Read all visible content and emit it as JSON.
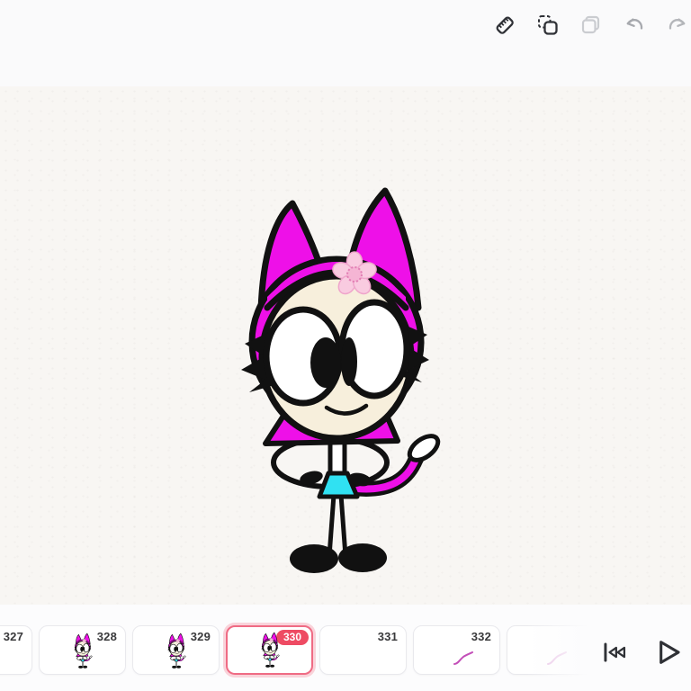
{
  "app": {
    "name": "animation-drawing-editor"
  },
  "toolbar": {
    "icons": [
      {
        "name": "ruler-icon",
        "state": "enabled",
        "color": "#2f3136"
      },
      {
        "name": "paste-selection-icon",
        "state": "enabled",
        "color": "#2f3136"
      },
      {
        "name": "duplicate-icon",
        "state": "disabled",
        "color": "#caccd0"
      },
      {
        "name": "undo-icon",
        "state": "disabled",
        "color": "#a7a9ae"
      },
      {
        "name": "redo-icon",
        "state": "disabled",
        "color": "#b4b6ba"
      }
    ]
  },
  "canvas": {
    "description": "cartoon cat-girl character: magenta hair and pointed ears, pink cherry-blossom flower on hair, cream face, two large white eyes with black pupils looking inward, spiky black lashes, magenta collar cape, white stick torso, arms looped akimbo, cyan triangle skirt, magenta tail with white tip, stick legs, black oval shoes",
    "colors": {
      "paper": "#f8f6f3",
      "hair_magenta": "#ee10e8",
      "face_cream": "#f7efdc",
      "skirt_cyan": "#30e1f2",
      "flower_petal": "#f9cbe0",
      "flower_center": "#f5b5d4",
      "outline": "#111111",
      "tail_tip": "#ffffff"
    }
  },
  "timeline": {
    "frames": [
      {
        "number": "327",
        "selected": false,
        "content": "empty",
        "clipped": "left-edge"
      },
      {
        "number": "328",
        "selected": false,
        "content": "character-thumbnail"
      },
      {
        "number": "329",
        "selected": false,
        "content": "character-thumbnail"
      },
      {
        "number": "330",
        "selected": true,
        "content": "character-thumbnail"
      },
      {
        "number": "331",
        "selected": false,
        "content": "empty"
      },
      {
        "number": "332",
        "selected": false,
        "content": "pink-squiggle"
      },
      {
        "number": "",
        "selected": false,
        "content": "pink-squiggle-faded"
      }
    ],
    "selected_frame_number": "330",
    "badge_color": "#ee4b63",
    "selected_border_color": "#ef6b84",
    "controls": [
      {
        "name": "skip-to-start-icon"
      },
      {
        "name": "play-icon"
      }
    ]
  }
}
